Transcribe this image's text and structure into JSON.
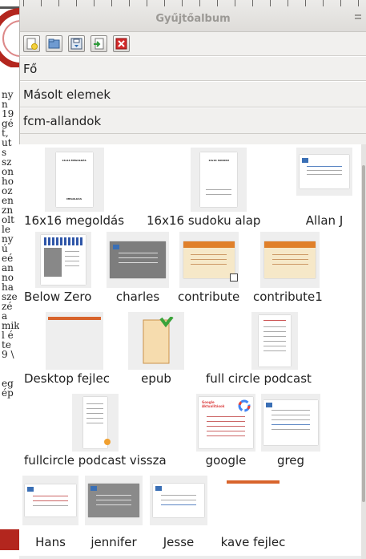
{
  "window": {
    "title": "Gyűjtőalbum"
  },
  "toolbar": {
    "buttons": [
      {
        "icon": "new-folder-icon"
      },
      {
        "icon": "open-icon"
      },
      {
        "icon": "save-icon"
      },
      {
        "icon": "add-item-icon"
      },
      {
        "icon": "delete-icon"
      }
    ]
  },
  "folders": {
    "fo": "Fő",
    "copied": "Másolt elemek",
    "fcm": "fcm-allandok"
  },
  "items": [
    {
      "label": "16x16 megoldás",
      "heading": "16x16 MEGOLDÁS",
      "footer": "MEGOLDÁS"
    },
    {
      "label": "16x16 sudoku alap",
      "heading": "16x16 SUDOKU"
    },
    {
      "label": "Allan J"
    },
    {
      "label": "Below Zero"
    },
    {
      "label": "charles"
    },
    {
      "label": "contribute"
    },
    {
      "label": "contribute1"
    },
    {
      "label": "Desktop fejlec"
    },
    {
      "label": "epub"
    },
    {
      "label": "full circle podcast"
    },
    {
      "label": "fullcircle podcast vissza"
    },
    {
      "label": "google",
      "heading": "Google Aktualitások"
    },
    {
      "label": "greg"
    },
    {
      "label": "Hans"
    },
    {
      "label": "jennifer"
    },
    {
      "label": "Jesse"
    },
    {
      "label": "kave fejlec"
    }
  ],
  "background_text": [
    "ny",
    "n",
    "19",
    "gé",
    "t,",
    "ut",
    "s",
    "sz",
    "on",
    "ho",
    "oz",
    "en",
    "zn",
    "olt",
    "le",
    "ny",
    "ú",
    "eé",
    "an",
    "no",
    "ha",
    "sze",
    "zé",
    "a",
    "mik",
    "l é",
    "te",
    "9 \\",
    "",
    "",
    "eg",
    "ép"
  ],
  "colors": {
    "accent_red": "#b3261e",
    "panel_bg": "#f1f0ee",
    "thumb_bg": "#eeeeee"
  }
}
